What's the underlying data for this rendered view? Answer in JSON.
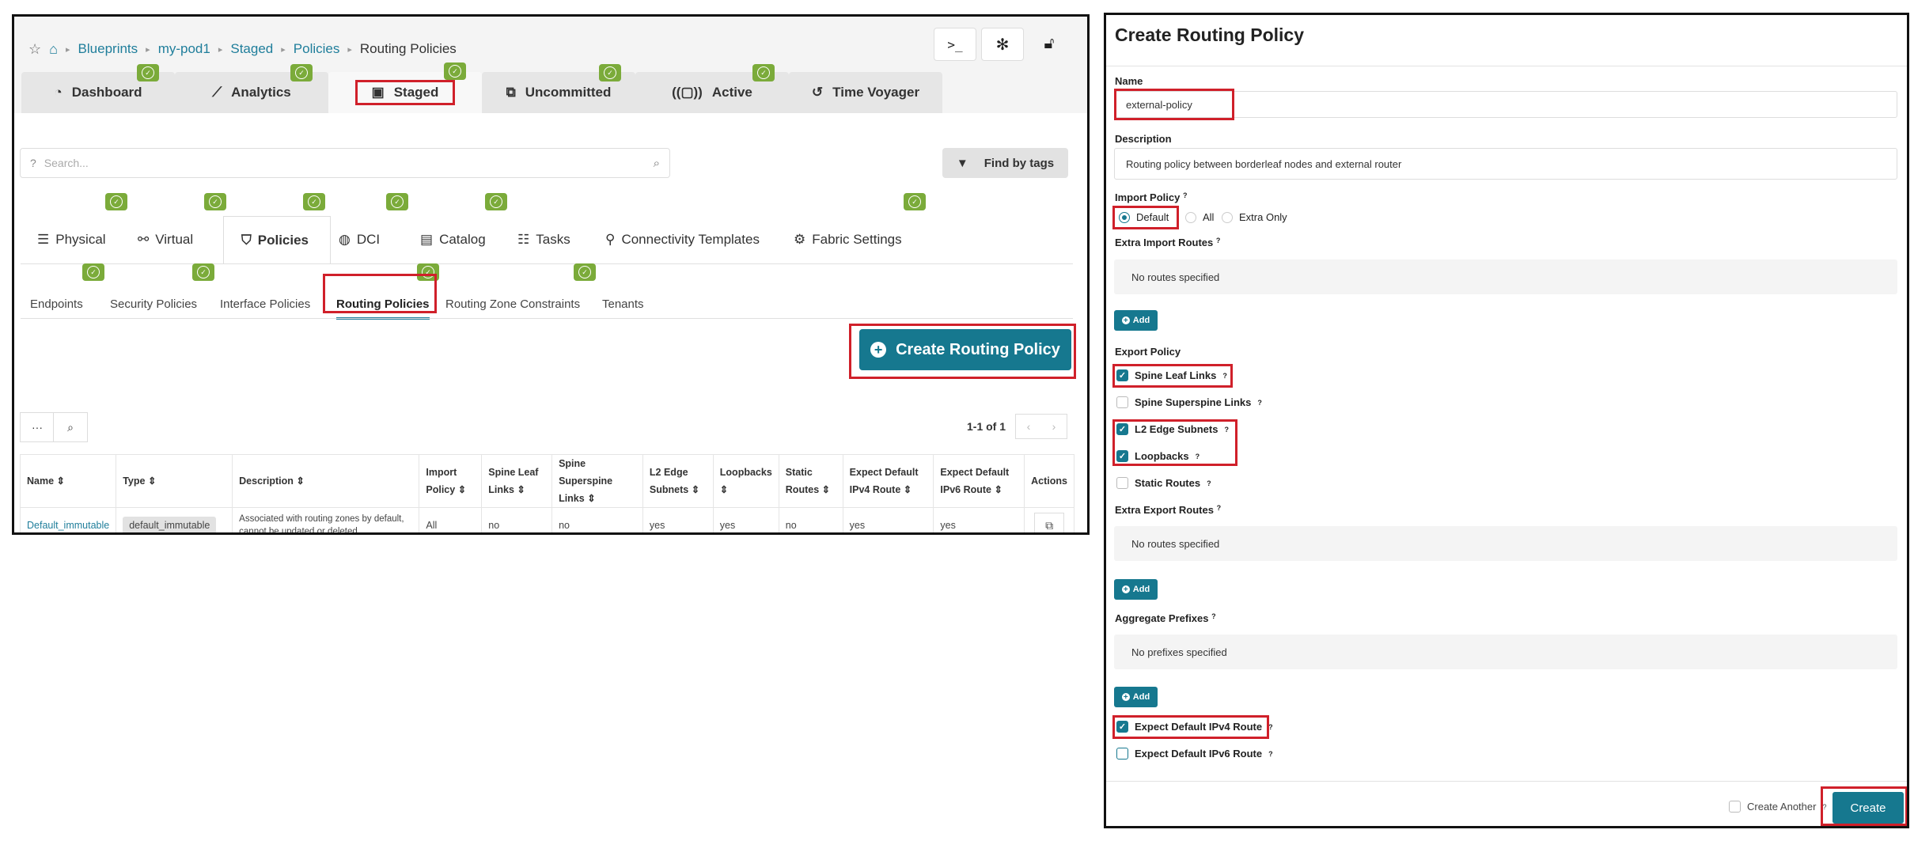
{
  "breadcrumb": {
    "items": [
      "Blueprints",
      "my-pod1",
      "Staged",
      "Policies",
      "Routing Policies"
    ]
  },
  "main_tabs": [
    "Dashboard",
    "Analytics",
    "Staged",
    "Uncommitted",
    "Active",
    "Time Voyager"
  ],
  "search": {
    "placeholder": "Search..."
  },
  "find_by_tags": "Find by tags",
  "sub_tabs": [
    "Physical",
    "Virtual",
    "Policies",
    "DCI",
    "Catalog",
    "Tasks",
    "Connectivity Templates",
    "Fabric Settings"
  ],
  "policy_tabs": [
    "Endpoints",
    "Security Policies",
    "Interface Policies",
    "Routing Policies",
    "Routing Zone Constraints",
    "Tenants"
  ],
  "create_button": "Create Routing Policy",
  "pager": {
    "range": "1-1 of 1"
  },
  "table": {
    "headers": [
      {
        "l1": "Name",
        "l2": ""
      },
      {
        "l1": "Type",
        "l2": ""
      },
      {
        "l1": "Description",
        "l2": ""
      },
      {
        "l1": "Import",
        "l2": "Policy"
      },
      {
        "l1": "Spine Leaf",
        "l2": "Links"
      },
      {
        "l1": "Spine Superspine",
        "l2": "Links"
      },
      {
        "l1": "L2 Edge",
        "l2": "Subnets"
      },
      {
        "l1": "Loopbacks",
        "l2": ""
      },
      {
        "l1": "Static",
        "l2": "Routes"
      },
      {
        "l1": "Expect Default",
        "l2": "IPv4 Route"
      },
      {
        "l1": "Expect Default",
        "l2": "IPv6 Route"
      },
      {
        "l1": "Actions",
        "l2": ""
      }
    ],
    "row": {
      "name": "Default_immutable",
      "type": "default_immutable",
      "desc1": "Associated with routing zones by default,",
      "desc2": "cannot be updated or deleted.",
      "import": "All",
      "spine_leaf": "no",
      "spine_superspine": "no",
      "l2_edge": "yes",
      "loopbacks": "yes",
      "static": "no",
      "ipv4": "yes",
      "ipv6": "yes"
    }
  },
  "form": {
    "title": "Create Routing Policy",
    "name_label": "Name",
    "name_value": "external-policy",
    "description_label": "Description",
    "description_value": "Routing policy between borderleaf nodes and external router",
    "import_policy_label": "Import Policy",
    "import_options": [
      "Default",
      "All",
      "Extra Only"
    ],
    "import_selected": "Default",
    "extra_import_label": "Extra Import Routes",
    "no_routes": "No routes specified",
    "add": "Add",
    "export_policy_label": "Export Policy",
    "spine_leaf_links": "Spine Leaf Links",
    "spine_superspine_links": "Spine Superspine Links",
    "l2_edge_subnets": "L2 Edge Subnets",
    "loopbacks": "Loopbacks",
    "static_routes": "Static Routes",
    "extra_export_label": "Extra Export Routes",
    "aggregate_label": "Aggregate Prefixes",
    "no_prefixes": "No prefixes specified",
    "expect_ipv4": "Expect Default IPv4 Route",
    "expect_ipv6": "Expect Default IPv6 Route",
    "create_another": "Create Another",
    "create": "Create"
  },
  "colors": {
    "accent": "#16788f",
    "badge": "#7bab3a",
    "highlight": "#d0202a",
    "link": "#1f7e9b"
  }
}
